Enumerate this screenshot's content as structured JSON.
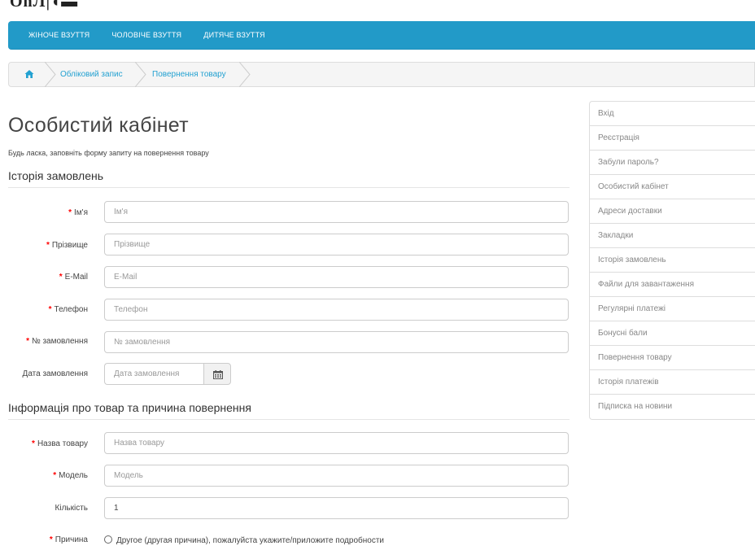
{
  "nav": {
    "items": [
      "ЖІНОЧЕ ВЗУТТЯ",
      "ЧОЛОВІЧЕ ВЗУТТЯ",
      "ДИТЯЧЕ ВЗУТТЯ"
    ]
  },
  "breadcrumb": {
    "home_icon": "home-icon",
    "items": [
      "Обліковий запис",
      "Повернення товару"
    ]
  },
  "page": {
    "title": "Особистий кабінет",
    "intro": "Будь ласка, заповніть форму запиту на повернення товару"
  },
  "order_section": {
    "legend": "Історія замовлень",
    "required_mark": "*",
    "fields": [
      {
        "label": "Ім'я",
        "placeholder": "Ім'я",
        "value": ""
      },
      {
        "label": "Прізвище",
        "placeholder": "Прізвище",
        "value": ""
      },
      {
        "label": "E-Mail",
        "placeholder": "E-Mail",
        "value": ""
      },
      {
        "label": "Телефон",
        "placeholder": "Телефон",
        "value": ""
      },
      {
        "label": "№ замовлення",
        "placeholder": "№ замовлення",
        "value": ""
      }
    ],
    "date": {
      "label": "Дата замовлення",
      "placeholder": "Дата замовлення",
      "button_icon": "calendar-icon"
    }
  },
  "product_section": {
    "legend": "Інформація про товар та причина повернення",
    "fields": [
      {
        "label": "Назва товару",
        "placeholder": "Назва товару",
        "value": "",
        "required": true
      },
      {
        "label": "Модель",
        "placeholder": "Модель",
        "value": "",
        "required": true
      },
      {
        "label": "Кількість",
        "placeholder": "",
        "value": "1",
        "required": false
      }
    ],
    "reason": {
      "label": "Причина",
      "options": [
        "Другое (другая причина), пожалуйста укажите/приложите подробности"
      ]
    }
  },
  "sidebar": {
    "items": [
      "Вхід",
      "Реєстрація",
      "Забули пароль?",
      "Особистий кабінет",
      "Адреси доставки",
      "Закладки",
      "Історія замовлень",
      "Файли для завантаження",
      "Регулярні платежі",
      "Бонусні бали",
      "Повернення товару",
      "Історія платежів",
      "Підписка на новини"
    ]
  },
  "colors": {
    "nav_bg": "#229ac8",
    "link": "#23a1d1",
    "required": "#ff0000"
  }
}
